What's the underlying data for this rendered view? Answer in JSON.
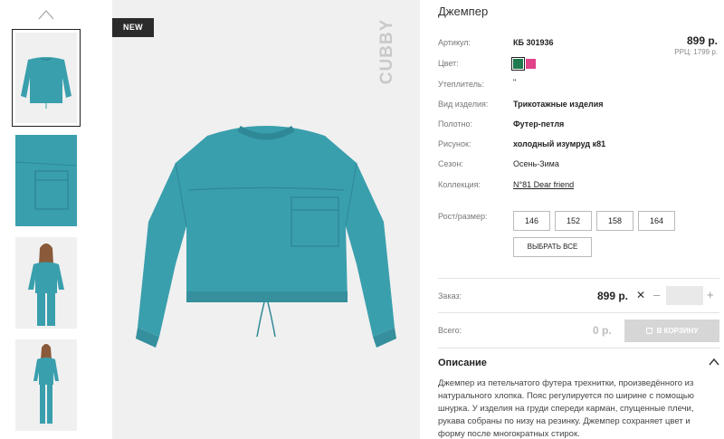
{
  "thumbnails": [
    {
      "alt": "Sweatshirt front"
    },
    {
      "alt": "Pocket detail"
    },
    {
      "alt": "Model front"
    },
    {
      "alt": "Model full"
    }
  ],
  "main": {
    "badge": "NEW",
    "brand": "CUBBY"
  },
  "product": {
    "title": "Джемпер",
    "price": "899 р.",
    "rrc": "РРЦ: 1799 р."
  },
  "specs": {
    "article": {
      "label": "Артикул:",
      "value": "КБ 301936"
    },
    "color": {
      "label": "Цвет:",
      "swatches": [
        "#1f7a4e",
        "#e0438a"
      ]
    },
    "insulation": {
      "label": "Утеплитель:",
      "value": "\""
    },
    "kind": {
      "label": "Вид изделия:",
      "value": "Трикотажные изделия"
    },
    "fabric": {
      "label": "Полотно:",
      "value": "Футер-петля"
    },
    "pattern": {
      "label": "Рисунок:",
      "value": "холодный изумруд к81"
    },
    "season": {
      "label": "Сезон:",
      "value": "Осень-Зима"
    },
    "collection": {
      "label": "Коллекция:",
      "value": "N°81 Dear friend"
    }
  },
  "sizes": {
    "label": "Рост/размер:",
    "options": [
      "146",
      "152",
      "158",
      "164"
    ],
    "select_all": "ВЫБРАТЬ ВСЕ"
  },
  "order": {
    "label": "Заказ:",
    "price": "899 р.",
    "remove": "✕",
    "minus": "–",
    "plus": "+",
    "qty": ""
  },
  "total": {
    "label": "Всего:",
    "value": "0 р.",
    "cart": "В КОРЗИНУ"
  },
  "description": {
    "title": "Описание",
    "text": "Джемпер из петельчатого футера трехнитки, произведённого из натурального хлопка. Пояс регулируется по ширине с помощью шнурка. У изделия на груди спереди карман, спущенные плечи, рукава собраны по низу на резинку. Джемпер сохраняет цвет и форму после многократных стирок."
  },
  "colors": {
    "garment": "#3a9fad",
    "garment_dark": "#2f8896",
    "background": "#f0f0f0"
  }
}
